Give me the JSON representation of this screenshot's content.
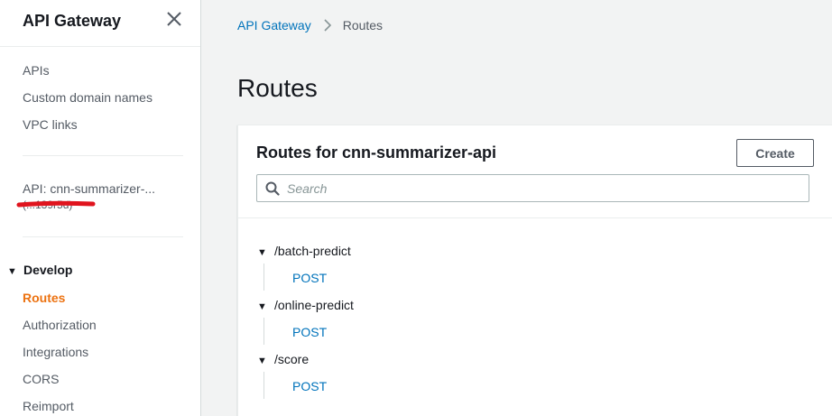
{
  "sidebar": {
    "title": "API Gateway",
    "nav_links": [
      "APIs",
      "Custom domain names",
      "VPC links"
    ],
    "api_label": "API: cnn-summarizer-...",
    "api_id": "(...139r5d)",
    "section": "Develop",
    "items": [
      {
        "label": "Routes",
        "active": true
      },
      {
        "label": "Authorization",
        "active": false
      },
      {
        "label": "Integrations",
        "active": false
      },
      {
        "label": "CORS",
        "active": false
      },
      {
        "label": "Reimport",
        "active": false
      }
    ]
  },
  "breadcrumb": {
    "root": "API Gateway",
    "current": "Routes"
  },
  "page": {
    "title": "Routes"
  },
  "panel": {
    "title": "Routes for cnn-summarizer-api",
    "create_label": "Create",
    "search_placeholder": "Search",
    "routes": [
      {
        "path": "/batch-predict",
        "method": "POST"
      },
      {
        "path": "/online-predict",
        "method": "POST"
      },
      {
        "path": "/score",
        "method": "POST"
      }
    ]
  },
  "colors": {
    "accent": "#ec7211",
    "link": "#0073bb",
    "redaction": "#e0141e"
  }
}
